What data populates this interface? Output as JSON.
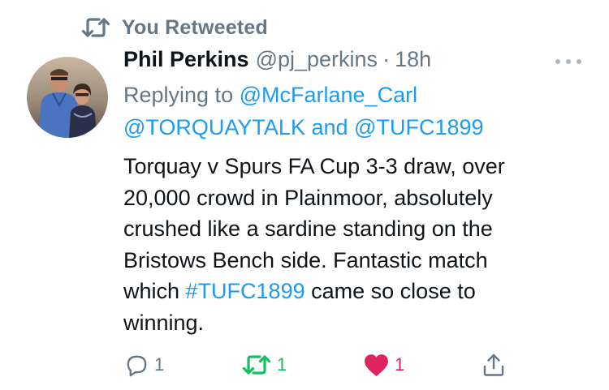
{
  "retweet_context": {
    "icon": "retweet-icon",
    "label": "You Retweeted"
  },
  "author": {
    "name": "Phil Perkins",
    "handle": "@pj_perkins",
    "separator": "·",
    "time": "18h",
    "avatar": "avatar-photo"
  },
  "reply": {
    "prefix": "Replying to",
    "user1": "@McFarlane_Carl",
    "user2": "@TORQUAYTALK",
    "conjunction": "and",
    "user3": "@TUFC1899"
  },
  "tweet": {
    "line1": "Torquay v Spurs FA Cup 3-3 draw, over",
    "line2": "20,000 crowd in Plainmoor, absolutely",
    "line3": "crushed like a sardine standing on the",
    "line4": "Bristows Bench side. Fantastic match",
    "line5_prefix": "which",
    "hashtag": "#TUFC1899",
    "line5_suffix": "came so close to",
    "line6": "winning."
  },
  "actions": {
    "reply_count": "1",
    "retweet_count": "1",
    "like_count": "1",
    "reply_icon": "reply-icon",
    "retweet_icon": "retweet-icon",
    "like_icon": "heart-icon",
    "share_icon": "share-icon"
  },
  "colors": {
    "link": "#1d9bf0",
    "secondary_text": "#657786",
    "retweet_green": "#17bf63",
    "like_red": "#e0245e"
  }
}
